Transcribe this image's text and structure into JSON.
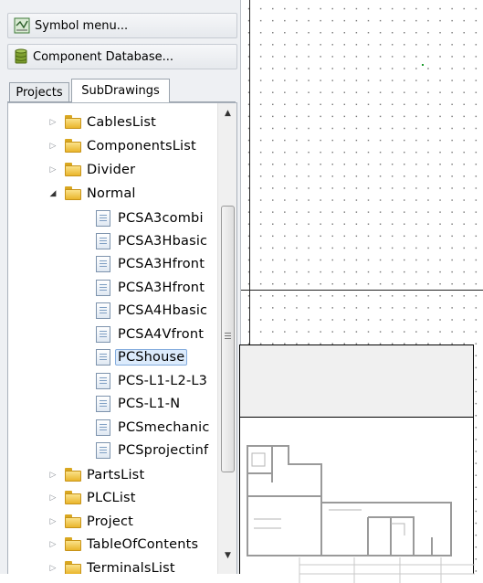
{
  "toolbar": {
    "symbol_menu": "Symbol menu...",
    "component_database": "Component Database..."
  },
  "tabs": [
    {
      "label": "Projects",
      "active": false
    },
    {
      "label": "SubDrawings",
      "active": true
    }
  ],
  "tree": {
    "items": [
      {
        "label": "CablesList",
        "type": "folder",
        "expanded": false
      },
      {
        "label": "ComponentsList",
        "type": "folder",
        "expanded": false
      },
      {
        "label": "Divider",
        "type": "folder",
        "expanded": false
      },
      {
        "label": "Normal",
        "type": "folder",
        "expanded": true
      },
      {
        "label": "PCSA3combi",
        "type": "file"
      },
      {
        "label": "PCSA3Hbasic",
        "type": "file"
      },
      {
        "label": "PCSA3Hfront",
        "type": "file"
      },
      {
        "label": "PCSA3Hfront",
        "type": "file"
      },
      {
        "label": "PCSA4Hbasic",
        "type": "file"
      },
      {
        "label": "PCSA4Vfront",
        "type": "file"
      },
      {
        "label": "PCShouse",
        "type": "file",
        "selected": true
      },
      {
        "label": "PCS-L1-L2-L3",
        "type": "file"
      },
      {
        "label": "PCS-L1-N",
        "type": "file"
      },
      {
        "label": "PCSmechanic",
        "type": "file"
      },
      {
        "label": "PCSprojectinf",
        "type": "file"
      },
      {
        "label": "PartsList",
        "type": "folder",
        "expanded": false
      },
      {
        "label": "PLCList",
        "type": "folder",
        "expanded": false
      },
      {
        "label": "Project",
        "type": "folder",
        "expanded": false
      },
      {
        "label": "TableOfContents",
        "type": "folder",
        "expanded": false
      },
      {
        "label": "TerminalsList",
        "type": "folder",
        "expanded": false
      }
    ]
  },
  "icons": {
    "symbol_menu": "symbol-grid-icon",
    "component_database": "database-icon",
    "folder": "folder-icon",
    "file": "drawing-file-icon"
  },
  "colors": {
    "panel_bg": "#eef0f3",
    "selection": "#dcebfc",
    "folder": "#f1c94a",
    "canvas_line": "#222222"
  }
}
